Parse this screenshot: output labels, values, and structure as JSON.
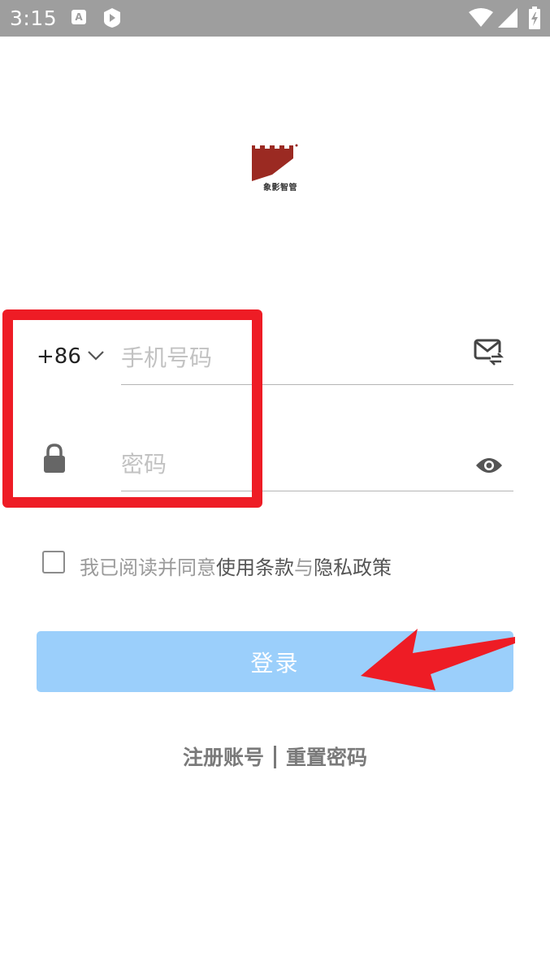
{
  "status_bar": {
    "time": "3:15",
    "icons": [
      "a-notification-icon",
      "play-store-icon",
      "wifi-icon",
      "signal-icon",
      "battery-icon"
    ]
  },
  "logo": {
    "caption": "象影智管",
    "color": "#9b2a22"
  },
  "form": {
    "country_code": "+86",
    "phone_placeholder": "手机号码",
    "password_placeholder": "密码"
  },
  "agreement": {
    "prefix": "我已阅读并同意",
    "terms": "使用条款",
    "and": "与",
    "privacy": "隐私政策"
  },
  "login_button": {
    "label": "登录",
    "color": "#9bcffb"
  },
  "links": {
    "register": "注册账号",
    "reset_password": "重置密码"
  },
  "annotation": {
    "color": "#ee1c25"
  }
}
